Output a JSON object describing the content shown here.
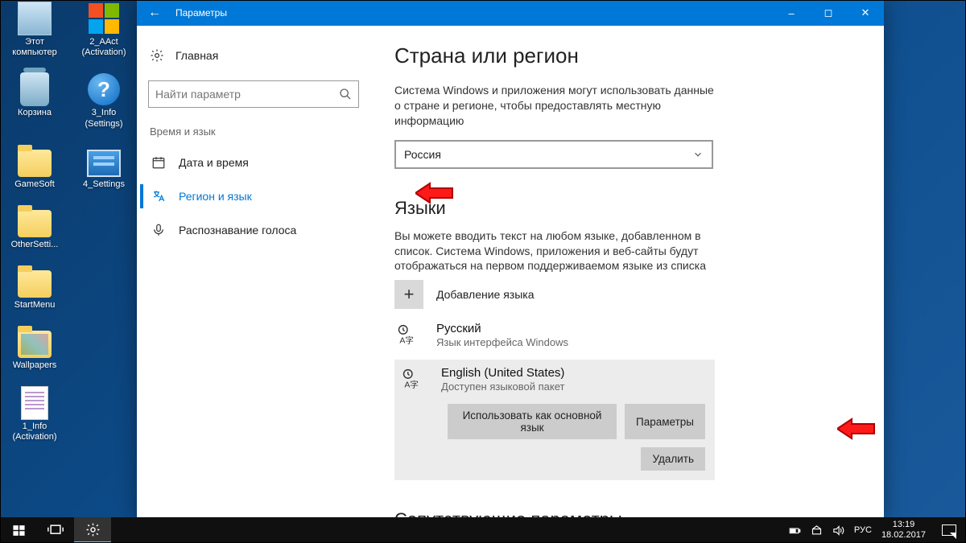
{
  "desktop": {
    "icons": [
      {
        "label": "Этот\nкомпьютер"
      },
      {
        "label": "2_AAct\n(Activation)"
      },
      {
        "label": "Корзина"
      },
      {
        "label": "3_Info\n(Settings)"
      },
      {
        "label": "GameSoft"
      },
      {
        "label": "4_Settings"
      },
      {
        "label": "OtherSetti..."
      },
      {
        "label": "StartMenu"
      },
      {
        "label": "Wallpapers"
      },
      {
        "label": "1_Info\n(Activation)"
      }
    ]
  },
  "window": {
    "title": "Параметры",
    "sidebar": {
      "home": "Главная",
      "search_placeholder": "Найти параметр",
      "group": "Время и язык",
      "items": [
        {
          "label": "Дата и время"
        },
        {
          "label": "Регион и язык"
        },
        {
          "label": "Распознавание голоса"
        }
      ]
    },
    "main": {
      "h_region": "Страна или регион",
      "region_descr": "Система Windows и приложения могут использовать данные о стране и регионе, чтобы предоставлять местную информацию",
      "region_value": "Россия",
      "h_langs": "Языки",
      "langs_descr": "Вы можете вводить текст на любом языке, добавленном в список. Система Windows, приложения и веб-сайты будут отображаться на первом поддерживаемом языке из списка",
      "add_lang": "Добавление языка",
      "lang1": {
        "title": "Русский",
        "sub": "Язык интерфейса Windows"
      },
      "lang2": {
        "title": "English (United States)",
        "sub": "Доступен языковой пакет"
      },
      "btn_default": "Использовать как основной язык",
      "btn_params": "Параметры",
      "btn_remove": "Удалить",
      "h_related": "Сопутствующие параметры"
    }
  },
  "taskbar": {
    "kb": "РУС",
    "time": "13:19",
    "date": "18.02.2017"
  }
}
